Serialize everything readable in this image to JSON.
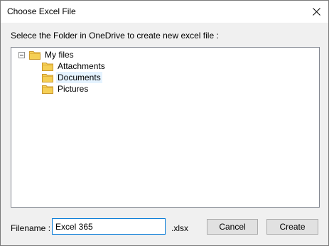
{
  "window": {
    "title": "Choose Excel File",
    "close_icon": "close-icon"
  },
  "prompt": "Selece the Folder in OneDrive to create new excel file :",
  "tree": {
    "root": {
      "label": "My files",
      "expanded": true,
      "icon": "folder-icon"
    },
    "children": [
      {
        "label": "Attachments",
        "icon": "folder-icon",
        "selected": false
      },
      {
        "label": "Documents",
        "icon": "folder-icon",
        "selected": true
      },
      {
        "label": "Pictures",
        "icon": "folder-icon",
        "selected": false
      }
    ]
  },
  "filename": {
    "label": "Filename :",
    "value": "Excel 365",
    "extension": ".xlsx"
  },
  "buttons": {
    "cancel": "Cancel",
    "create": "Create"
  },
  "colors": {
    "folder": "#e8b93a",
    "selection": "#e5f3ff",
    "focus_border": "#0078d7"
  }
}
